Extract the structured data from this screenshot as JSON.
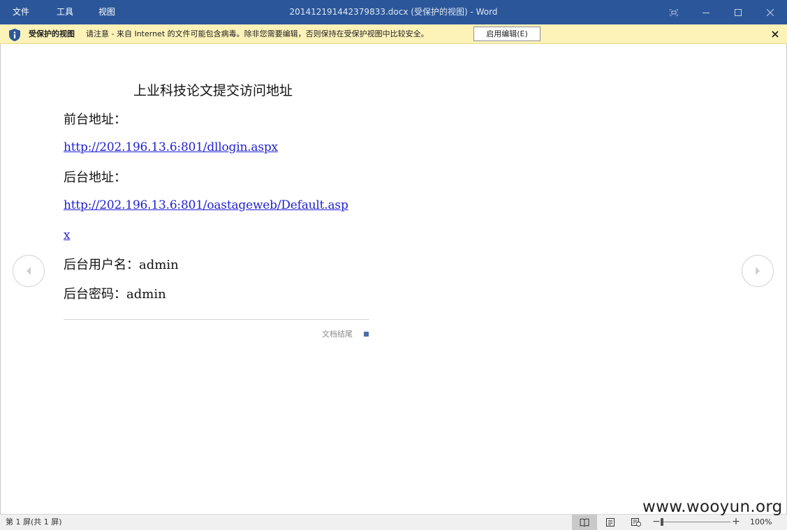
{
  "titlebar": {
    "menu": [
      "文件",
      "工具",
      "视图"
    ],
    "window_title": "201412191442379833.docx (受保护的视图) - Word"
  },
  "infobar": {
    "label": "受保护的视图",
    "message": "请注意 - 来自 Internet 的文件可能包含病毒。除非您需要编辑，否则保持在受保护视图中比较安全。",
    "enable_button": "启用编辑(E)"
  },
  "document": {
    "title": "上业科技论文提交访问地址",
    "lines": [
      "前台地址：",
      "http://202.196.13.6:801/dllogin.aspx",
      "后台地址：",
      "http://202.196.13.6:801/oastageweb/Default.asp",
      "x",
      "后台用户名：admin",
      "后台密码：admin"
    ],
    "end_label": "文档结尾"
  },
  "statusbar": {
    "page_info": "第 1 屏(共 1 屏)",
    "zoom": "100%",
    "zoom_fraction": 0.0
  },
  "watermark": "www.wooyun.org",
  "colors": {
    "titlebar": "#2b579a",
    "infobar": "#fdf3b9",
    "link": "#1f1fd1"
  }
}
